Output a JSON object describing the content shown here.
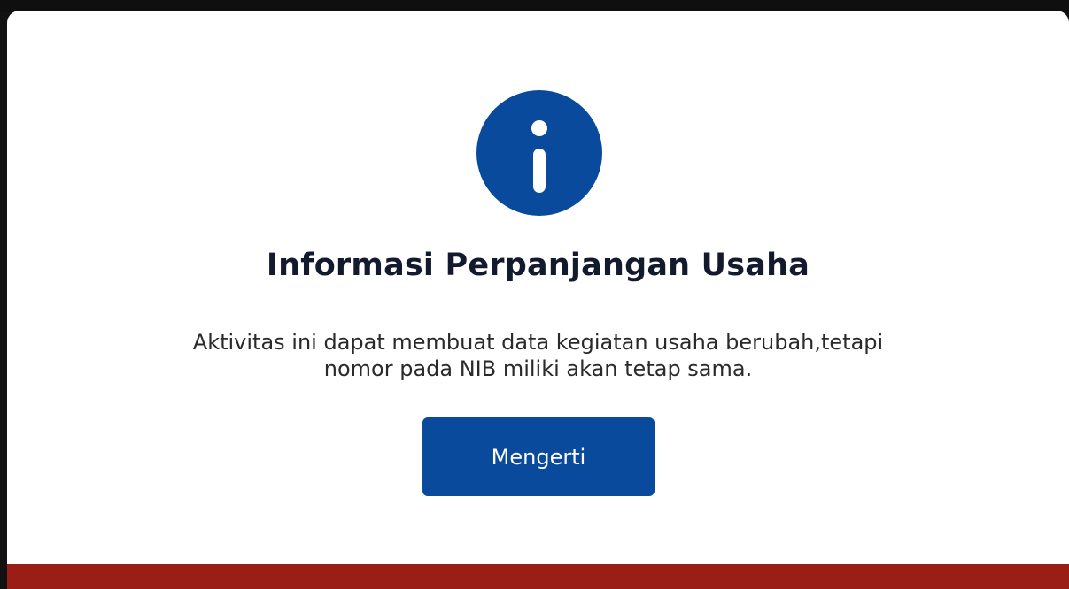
{
  "dialog": {
    "title": "Informasi Perpanjangan Usaha",
    "message_lines": [
      "Aktivitas ini dapat membuat data kegiatan usaha berubah,tetapi",
      "nomor pada NIB miliki akan tetap sama."
    ],
    "confirm_label": "Mengerti",
    "icon": "info-icon"
  },
  "colors": {
    "accent": "#0a4a9c",
    "footer_band": "#9a1d16",
    "title_text": "#141a2e",
    "body_text": "#2a2a2a"
  }
}
